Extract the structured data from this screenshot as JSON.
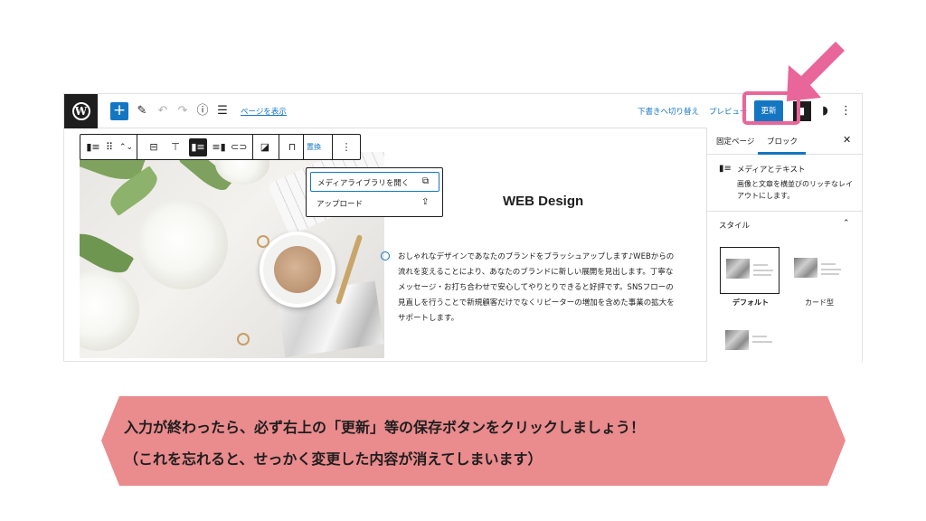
{
  "toolbar": {
    "view_page": "ページを表示",
    "switch_to_draft": "下書きへ切り替え",
    "preview": "プレビュー",
    "update": "更新"
  },
  "block_toolbar": {
    "replace": "置換"
  },
  "media_menu": {
    "open_library": "メディアライブラリを開く",
    "upload": "アップロード"
  },
  "content": {
    "heading": "WEB Design",
    "body_lines": [
      "おしゃれなデザインであなたのブランドをブラッシュアップします♪WEBからの",
      "流れを変えることにより、あなたのブランドに新しい展開を見出します。丁寧な",
      "メッセージ・お打ち合わせで安心してやりとりできると好評です。SNSフローの",
      "見直しを行うことで新規顧客だけでなくリピーターの増加を含めた事業の拡大を",
      "サポートします。"
    ]
  },
  "sidebar": {
    "tabs": [
      "固定ページ",
      "ブロック"
    ],
    "active_tab": "ブロック",
    "block_name": "メディアとテキスト",
    "block_description": "画像と文章を横並びのリッチなレイアウトにします。",
    "styles_title": "スタイル",
    "styles": [
      {
        "label": "デフォルト",
        "selected": true
      },
      {
        "label": "カード型",
        "selected": false
      },
      {
        "label": "",
        "selected": false
      }
    ]
  },
  "instruction": {
    "line1": "入力が終わったら、必ず右上の「更新」等の保存ボタンをクリックしましょう！",
    "line2": "（これを忘れると、せっかく変更した内容が消えてしまいます）"
  },
  "icons": {
    "logo": "wordpress-logo-icon",
    "add": "plus-icon",
    "tools": "pencil-icon",
    "undo": "undo-icon",
    "redo": "redo-icon",
    "details": "info-icon",
    "outline": "list-view-icon",
    "settings": "settings-icon",
    "jetpack": "jetpack-icon",
    "options": "more-vertical-icon",
    "arrow": "pointer-arrow-icon"
  },
  "colors": {
    "accent": "#1476c2",
    "highlight": "#e9669a",
    "banner": "#ea8b8d",
    "dark": "#1e1e1e"
  }
}
